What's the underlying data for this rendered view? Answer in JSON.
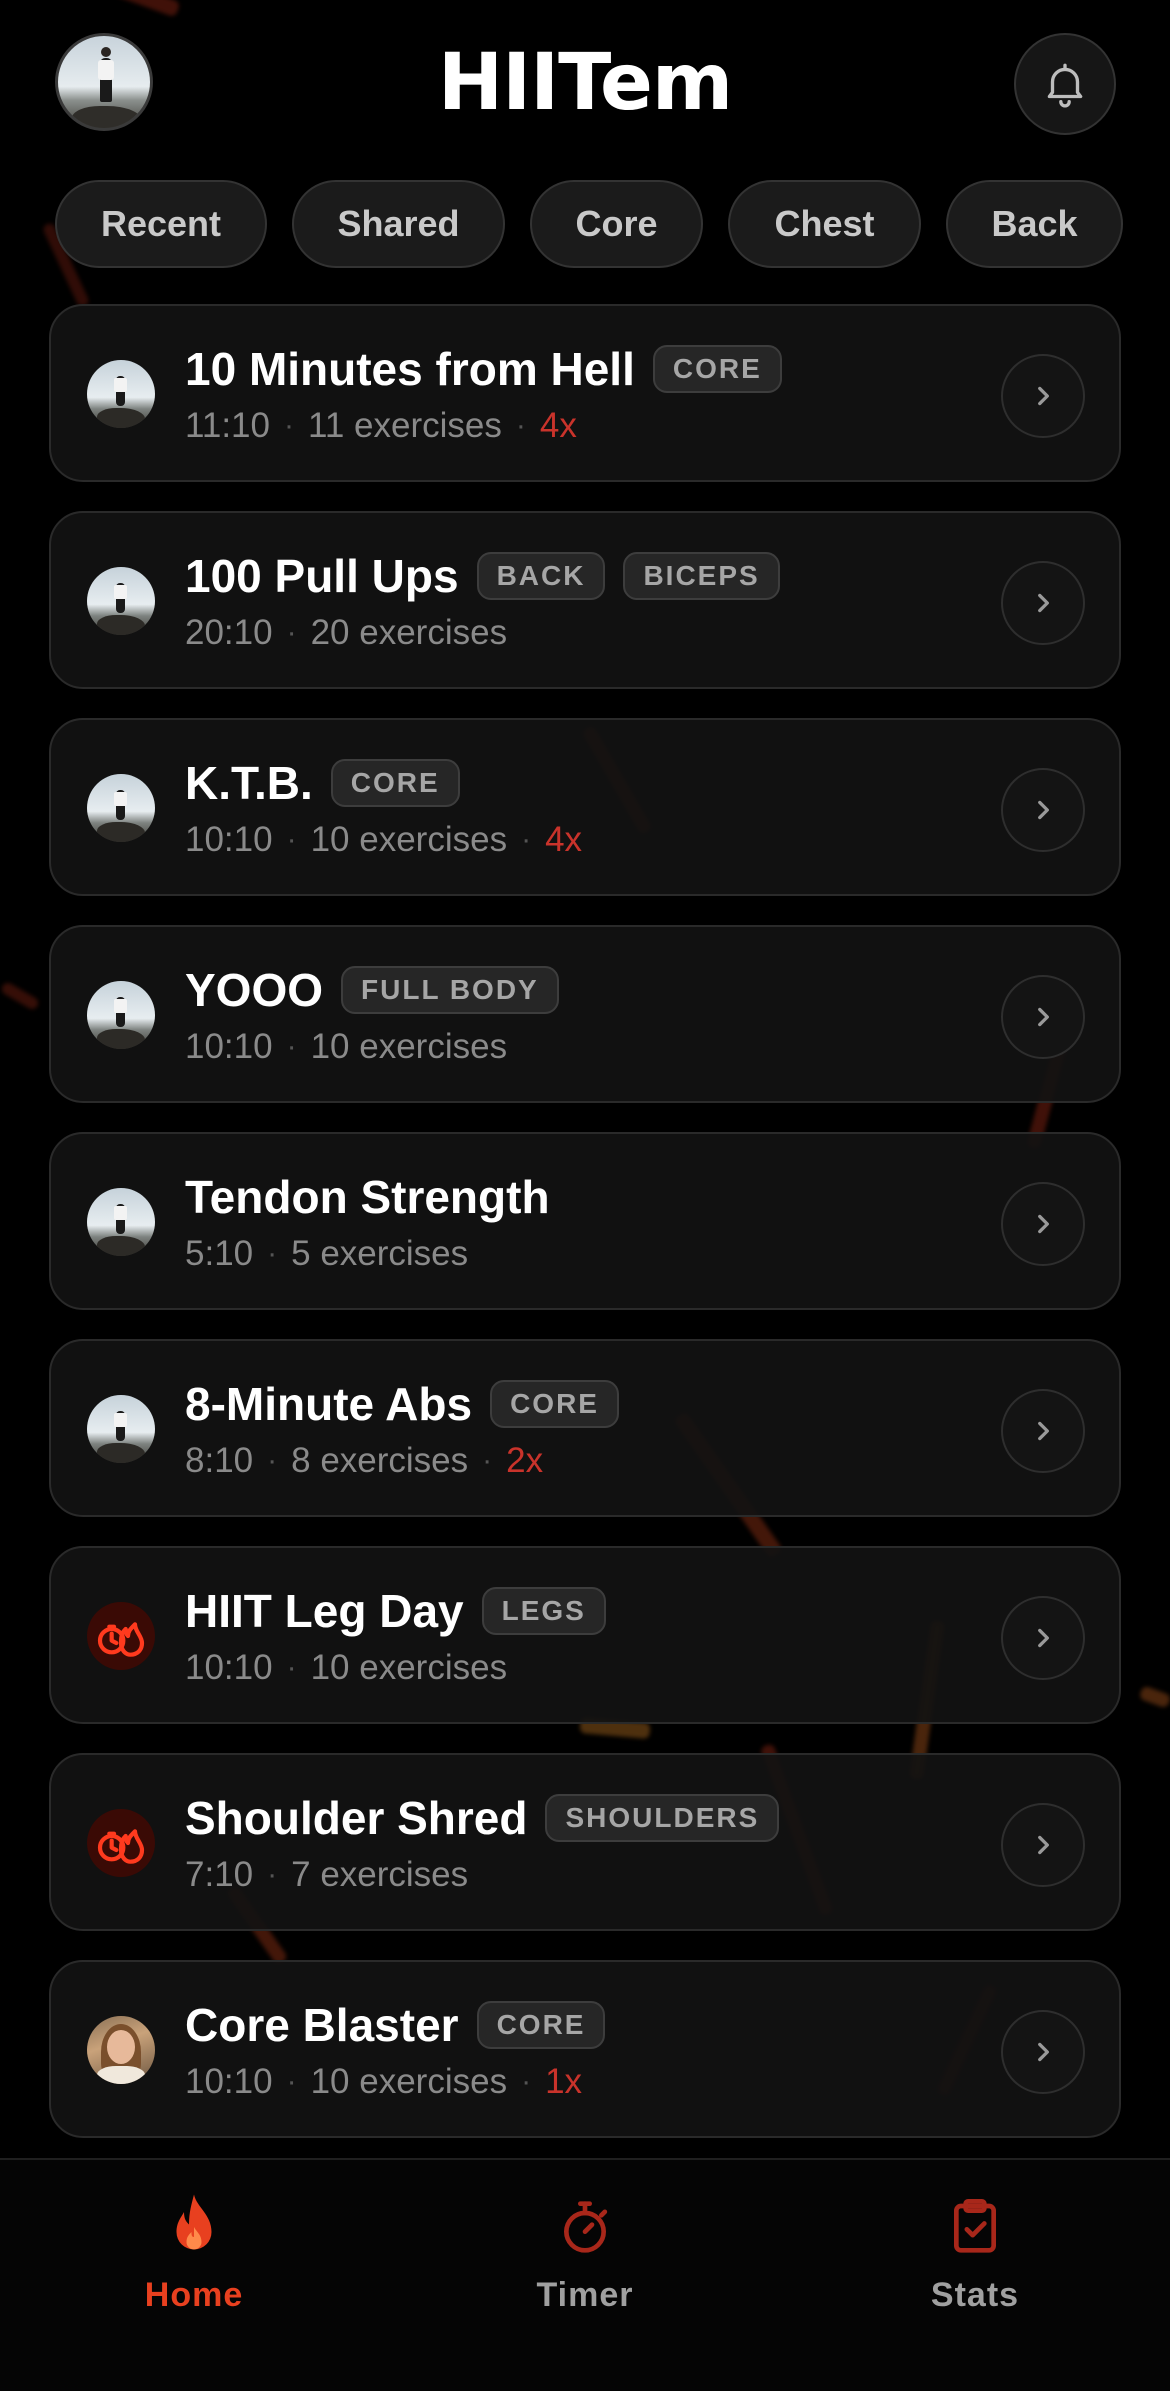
{
  "header": {
    "app_title": "HIITem"
  },
  "filters": [
    {
      "label": "Recent"
    },
    {
      "label": "Shared"
    },
    {
      "label": "Core"
    },
    {
      "label": "Chest"
    },
    {
      "label": "Back"
    }
  ],
  "workouts": [
    {
      "title": "10 Minutes from Hell",
      "tags": [
        "CORE"
      ],
      "duration": "11:10",
      "exercises": "11 exercises",
      "reps": "4x",
      "avatar": "user-photo"
    },
    {
      "title": "100 Pull Ups",
      "tags": [
        "BACK",
        "BICEPS"
      ],
      "duration": "20:10",
      "exercises": "20 exercises",
      "reps": "",
      "avatar": "user-photo"
    },
    {
      "title": "K.T.B.",
      "tags": [
        "CORE"
      ],
      "duration": "10:10",
      "exercises": "10 exercises",
      "reps": "4x",
      "avatar": "user-photo"
    },
    {
      "title": "YOOO",
      "tags": [
        "FULL BODY"
      ],
      "duration": "10:10",
      "exercises": "10 exercises",
      "reps": "",
      "avatar": "user-photo"
    },
    {
      "title": "Tendon Strength",
      "tags": [],
      "duration": "5:10",
      "exercises": "5 exercises",
      "reps": "",
      "avatar": "user-photo"
    },
    {
      "title": "8-Minute Abs",
      "tags": [
        "CORE"
      ],
      "duration": "8:10",
      "exercises": "8 exercises",
      "reps": "2x",
      "avatar": "user-photo"
    },
    {
      "title": "HIIT Leg Day",
      "tags": [
        "LEGS"
      ],
      "duration": "10:10",
      "exercises": "10 exercises",
      "reps": "",
      "avatar": "app-icon"
    },
    {
      "title": "Shoulder Shred",
      "tags": [
        "SHOULDERS"
      ],
      "duration": "7:10",
      "exercises": "7 exercises",
      "reps": "",
      "avatar": "app-icon"
    },
    {
      "title": "Core Blaster",
      "tags": [
        "CORE"
      ],
      "duration": "10:10",
      "exercises": "10 exercises",
      "reps": "1x",
      "avatar": "person-photo"
    }
  ],
  "tabbar": {
    "home": "Home",
    "timer": "Timer",
    "stats": "Stats",
    "active": "home"
  },
  "colors": {
    "accent": "#e8401f",
    "reps": "#c9332b",
    "background": "#000000",
    "card": "#121212"
  },
  "icons": [
    "bell-icon",
    "chevron-right-icon",
    "flame-icon",
    "stopwatch-icon",
    "clipboard-check-icon",
    "app-flame-timer-icon"
  ]
}
